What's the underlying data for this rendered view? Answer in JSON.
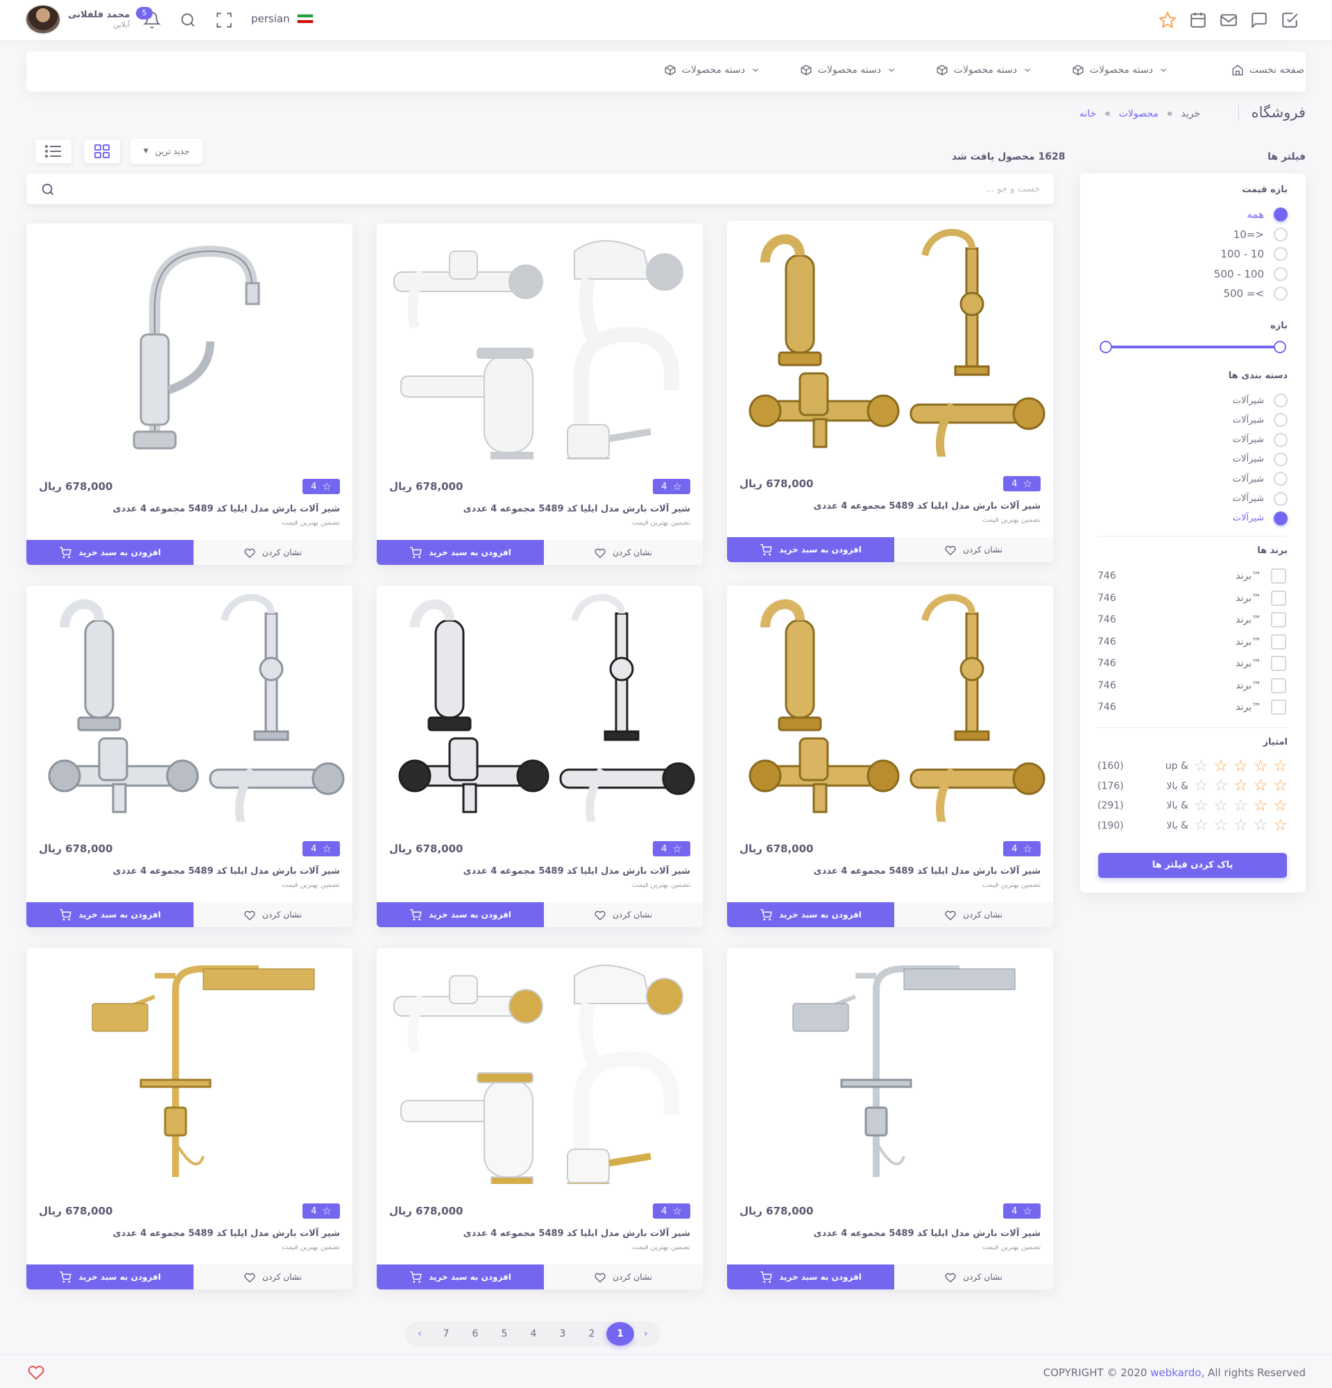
{
  "navbar": {
    "user_name": "محمد فلفلانی",
    "user_status": "آنلاین",
    "notification_count": "5",
    "language": "persian",
    "right_icons": [
      "star-icon",
      "calendar-icon",
      "mail-icon",
      "message-icon",
      "check-square-icon"
    ]
  },
  "menu": {
    "items": [
      {
        "label": "صفحه نخست",
        "icon": "home-icon"
      },
      {
        "label": "دسته محصولات",
        "icon": "box-icon"
      },
      {
        "label": "دسته محصولات",
        "icon": "box-icon"
      },
      {
        "label": "دسته محصولات",
        "icon": "box-icon"
      },
      {
        "label": "دسته محصولات",
        "icon": "box-icon"
      }
    ]
  },
  "breadcrumb": {
    "title": "فروشگاه",
    "items": [
      "خانه",
      "محصولات",
      "خرید"
    ],
    "separator": "»"
  },
  "filters": {
    "title": "فیلتر ها",
    "price_range": {
      "heading": "بازه قیمت",
      "options": [
        "همه",
        "10=>",
        "100 - 10",
        "500 - 100",
        "500 =<"
      ],
      "selected": 0
    },
    "range_heading": "بازه",
    "categories": {
      "heading": "دسته بندی ها",
      "options": [
        "شیرآلات",
        "شیرآلات",
        "شیرآلات",
        "شیرآلات",
        "شیرآلات",
        "شیرآلات",
        "شیرآلات"
      ],
      "selected": 6
    },
    "brands": {
      "heading": "برند ها",
      "items": [
        {
          "label": "برند™",
          "count": "746"
        },
        {
          "label": "برند™",
          "count": "746"
        },
        {
          "label": "برند™",
          "count": "746"
        },
        {
          "label": "برند™",
          "count": "746"
        },
        {
          "label": "برند™",
          "count": "746"
        },
        {
          "label": "برند™",
          "count": "746"
        },
        {
          "label": "برند™",
          "count": "746"
        }
      ]
    },
    "rating": {
      "heading": "امتیاز",
      "rows": [
        {
          "stars": 4,
          "label": "up &",
          "count": "(160)"
        },
        {
          "stars": 3,
          "label": "بالا &",
          "count": "(176)"
        },
        {
          "stars": 2,
          "label": "بالا &",
          "count": "(291)"
        },
        {
          "stars": 1,
          "label": "بالا &",
          "count": "(190)"
        }
      ]
    },
    "clear_label": "پاک کردن فیلتر ها"
  },
  "results": {
    "count_text": "1628 محصول یافت شد",
    "sort_label": "جدید ترین",
    "search_placeholder": "جست و جو ..."
  },
  "products": [
    {
      "image": "gold-faucet-set",
      "rating": "4",
      "price": "678,000 ریال",
      "title": "شیر آلات بارش مدل ایلیا کد 5489 مجموعه 4 عددی",
      "subtitle": "تضمین بهترین قیمت",
      "wish_label": "نشان کردن",
      "cart_label": "افزودن به سبد خرید"
    },
    {
      "image": "white-faucet-set",
      "rating": "4",
      "price": "678,000 ریال",
      "title": "شیر آلات بارش مدل ایلیا کد 5489 مجموعه 4 عددی",
      "subtitle": "تضمین بهترین قیمت",
      "wish_label": "نشان کردن",
      "cart_label": "افزودن به سبد خرید"
    },
    {
      "image": "chrome-kitchen-faucet",
      "rating": "4",
      "price": "678,000 ریال",
      "title": "شیر آلات بارش مدل ایلیا کد 5489 مجموعه 4 عددی",
      "subtitle": "تضمین بهترین قیمت",
      "wish_label": "نشان کردن",
      "cart_label": "افزودن به سبد خرید"
    },
    {
      "image": "gold-classic-faucet-set",
      "rating": "4",
      "price": "678,000 ریال",
      "title": "شیر آلات بارش مدل ایلیا کد 5489 مجموعه 4 عددی",
      "subtitle": "تضمین بهترین قیمت",
      "wish_label": "نشان کردن",
      "cart_label": "افزودن به سبد خرید"
    },
    {
      "image": "black-chrome-faucet-set",
      "rating": "4",
      "price": "678,000 ریال",
      "title": "شیر آلات بارش مدل ایلیا کد 5489 مجموعه 4 عددی",
      "subtitle": "تضمین بهترین قیمت",
      "wish_label": "نشان کردن",
      "cart_label": "افزودن به سبد خرید"
    },
    {
      "image": "chrome-faucet-set",
      "rating": "4",
      "price": "678,000 ریال",
      "title": "شیر آلات بارش مدل ایلیا کد 5489 مجموعه 4 عددی",
      "subtitle": "تضمین بهترین قیمت",
      "wish_label": "نشان کردن",
      "cart_label": "افزودن به سبد خرید"
    },
    {
      "image": "chrome-shower-column",
      "rating": "4",
      "price": "678,000 ریال",
      "title": "شیر آلات بارش مدل ایلیا کد 5489 مجموعه 4 عددی",
      "subtitle": "تضمین بهترین قیمت",
      "wish_label": "نشان کردن",
      "cart_label": "افزودن به سبد خرید"
    },
    {
      "image": "white-gold-faucet-set",
      "rating": "4",
      "price": "678,000 ریال",
      "title": "شیر آلات بارش مدل ایلیا کد 5489 مجموعه 4 عددی",
      "subtitle": "تضمین بهترین قیمت",
      "wish_label": "نشان کردن",
      "cart_label": "افزودن به سبد خرید"
    },
    {
      "image": "gold-shower-column",
      "rating": "4",
      "price": "678,000 ریال",
      "title": "شیر آلات بارش مدل ایلیا کد 5489 مجموعه 4 عددی",
      "subtitle": "تضمین بهترین قیمت",
      "wish_label": "نشان کردن",
      "cart_label": "افزودن به سبد خرید"
    }
  ],
  "pagination": {
    "pages": [
      "1",
      "2",
      "3",
      "4",
      "5",
      "6",
      "7"
    ],
    "active": "1",
    "prev": "‹",
    "next": "›"
  },
  "footer": {
    "copyright_prefix": "COPYRIGHT © 2020 ",
    "copyright_link": "webkardo",
    "copyright_suffix": ", All rights Reserved"
  },
  "colors": {
    "primary": "#7367f0",
    "star": "#ff9f43",
    "text": "#5e5873",
    "gold": "#c9a13b",
    "chrome": "#b9bec6"
  }
}
